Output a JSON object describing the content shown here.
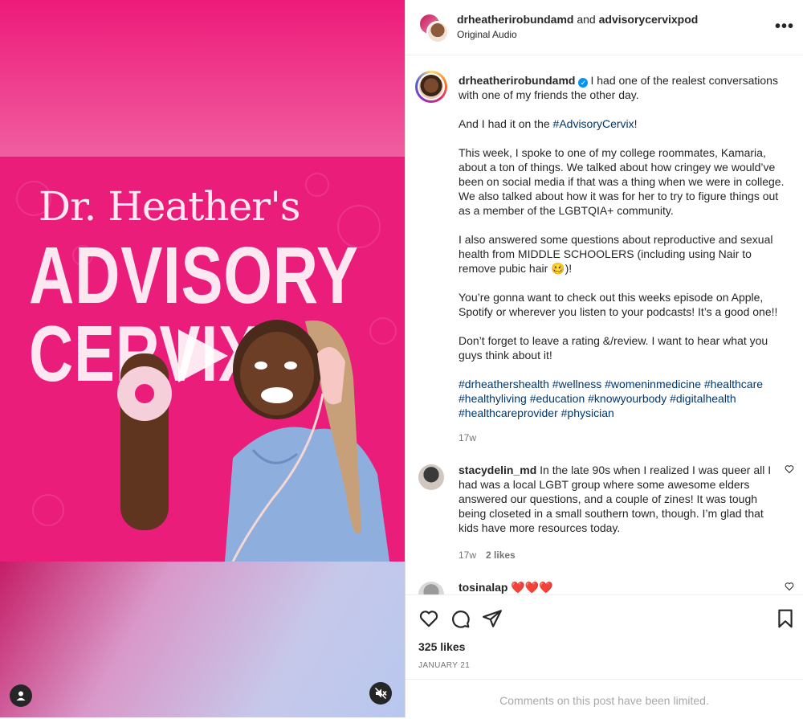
{
  "post": {
    "header": {
      "user_primary": "drheatherirobundamd",
      "and_text": "and",
      "user_secondary": "advisorycervixpod",
      "audio": "Original Audio",
      "more_label": "•••"
    },
    "media": {
      "title_script": "Dr. Heather's",
      "title_line1": "ADVISORY",
      "title_line2": "CERVIX",
      "colors": {
        "brand_pink": "#ea1d7b",
        "title_text": "#fde7f1"
      }
    },
    "caption": {
      "username": "drheatherirobundamd",
      "verified_icon": "verified-badge-icon",
      "intro": "I had one of the realest conversations with one of my friends the other day.",
      "p2_before": "And I had it on the ",
      "p2_tag": "#AdvisoryCervix",
      "p2_after": "!",
      "p3": "This week, I spoke to one of my college roommates, Kamaria, about a ton of things. We talked about how cringey we would’ve been on social media if that was a thing when we were in college. We also talked about how it was for her to try to figure things out as a member of the LGBTQIA+ community.",
      "p4": "I also answered some questions about reproductive and sexual health from MIDDLE SCHOOLERS (including using Nair to remove pubic hair 🥴)!",
      "p5": "You’re gonna want to check out this weeks episode on Apple, Spotify or wherever you listen to your podcasts! It’s a good one!!",
      "p6": "Don’t forget to leave a rating &/review. I want to hear what you guys think about it!",
      "hashtags": [
        "#drheathershealth",
        "#wellness",
        "#womeninmedicine",
        "#healthcare",
        "#healthyliving",
        "#education",
        "#knowyourbody",
        "#digitalhealth",
        "#healthcareprovider",
        "#physician"
      ],
      "time": "17w"
    },
    "comments": [
      {
        "username": "stacydelin_md",
        "text": "In the late 90s when I realized I was queer all I had was a local LGBT group where some awesome elders answered our questions, and a couple of zines! It was tough being closeted in a small southern town, though. I’m glad that kids have more resources today.",
        "time": "17w",
        "likes": "2 likes"
      },
      {
        "username": "tosinalap",
        "text": "❤️❤️❤️"
      }
    ],
    "footer": {
      "likes": "325 likes",
      "date": "JANUARY 21",
      "limited": "Comments on this post have been limited."
    }
  }
}
